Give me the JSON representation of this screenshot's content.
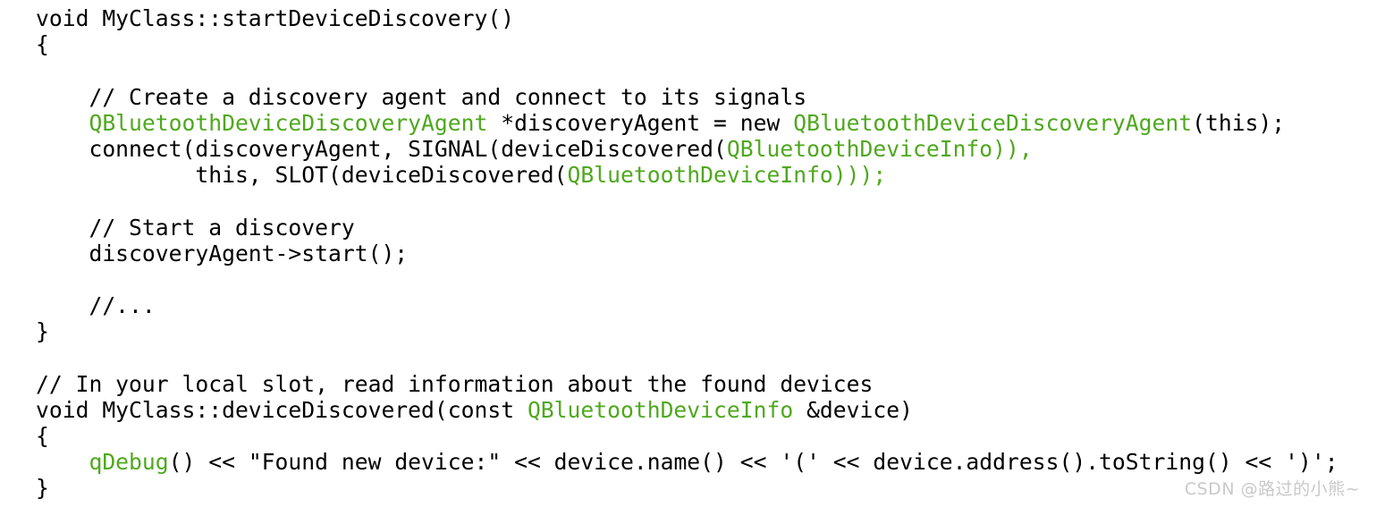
{
  "page": {
    "background_color": "#ffffff",
    "text_color": "#000000",
    "accent_color": "#4FA81E",
    "language": "cpp"
  },
  "code": {
    "lines": [
      {
        "index": 1,
        "indent": 0,
        "text": "void MyClass::startDeviceDiscovery()",
        "tokens": [
          {
            "t": "void MyClass::startDeviceDiscovery()",
            "c": "plain"
          }
        ]
      },
      {
        "index": 2,
        "indent": 0,
        "text": "{",
        "tokens": [
          {
            "t": "{",
            "c": "plain"
          }
        ]
      },
      {
        "index": 3,
        "indent": 0,
        "text": "",
        "tokens": []
      },
      {
        "index": 4,
        "indent": 4,
        "text": "    // Create a discovery agent and connect to its signals",
        "tokens": [
          {
            "t": "    // Create a discovery agent and connect to its signals",
            "c": "plain"
          }
        ]
      },
      {
        "index": 5,
        "indent": 4,
        "text": "    QBluetoothDeviceDiscoveryAgent *discoveryAgent = new QBluetoothDeviceDiscoveryAgent(this);",
        "tokens": [
          {
            "t": "    ",
            "c": "plain"
          },
          {
            "t": "QBluetoothDeviceDiscoveryAgent",
            "c": "type"
          },
          {
            "t": " *discoveryAgent = new ",
            "c": "plain"
          },
          {
            "t": "QBluetoothDeviceDiscoveryAgent",
            "c": "type"
          },
          {
            "t": "(this);",
            "c": "plain"
          }
        ]
      },
      {
        "index": 6,
        "indent": 4,
        "text": "    connect(discoveryAgent, SIGNAL(deviceDiscovered(QBluetoothDeviceInfo)),",
        "tokens": [
          {
            "t": "    connect(discoveryAgent, SIGNAL(deviceDiscovered(",
            "c": "plain"
          },
          {
            "t": "QBluetoothDeviceInfo",
            "c": "type"
          },
          {
            "t": ")),",
            "c": "type"
          }
        ]
      },
      {
        "index": 7,
        "indent": 12,
        "text": "            this, SLOT(deviceDiscovered(QBluetoothDeviceInfo)));",
        "tokens": [
          {
            "t": "            this, SLOT(deviceDiscovered(",
            "c": "plain"
          },
          {
            "t": "QBluetoothDeviceInfo",
            "c": "type"
          },
          {
            "t": ")));",
            "c": "type"
          }
        ]
      },
      {
        "index": 8,
        "indent": 0,
        "text": "",
        "tokens": []
      },
      {
        "index": 9,
        "indent": 4,
        "text": "    // Start a discovery",
        "tokens": [
          {
            "t": "    // Start a discovery",
            "c": "plain"
          }
        ]
      },
      {
        "index": 10,
        "indent": 4,
        "text": "    discoveryAgent->start();",
        "tokens": [
          {
            "t": "    discoveryAgent->start();",
            "c": "plain"
          }
        ]
      },
      {
        "index": 11,
        "indent": 0,
        "text": "",
        "tokens": []
      },
      {
        "index": 12,
        "indent": 4,
        "text": "    //...",
        "tokens": [
          {
            "t": "    //...",
            "c": "plain"
          }
        ]
      },
      {
        "index": 13,
        "indent": 0,
        "text": "}",
        "tokens": [
          {
            "t": "}",
            "c": "plain"
          }
        ]
      },
      {
        "index": 14,
        "indent": 0,
        "text": "",
        "tokens": []
      },
      {
        "index": 15,
        "indent": 0,
        "text": "// In your local slot, read information about the found devices",
        "tokens": [
          {
            "t": "// In your local slot, read information about the found devices",
            "c": "plain"
          }
        ]
      },
      {
        "index": 16,
        "indent": 0,
        "text": "void MyClass::deviceDiscovered(const QBluetoothDeviceInfo &device)",
        "tokens": [
          {
            "t": "void MyClass::deviceDiscovered(const ",
            "c": "plain"
          },
          {
            "t": "QBluetoothDeviceInfo",
            "c": "type"
          },
          {
            "t": " &device)",
            "c": "plain"
          }
        ]
      },
      {
        "index": 17,
        "indent": 0,
        "text": "{",
        "tokens": [
          {
            "t": "{",
            "c": "plain"
          }
        ]
      },
      {
        "index": 18,
        "indent": 4,
        "text": "    qDebug() << \"Found new device:\" << device.name() << '(' << device.address().toString() << ')';",
        "tokens": [
          {
            "t": "    ",
            "c": "plain"
          },
          {
            "t": "qDebug",
            "c": "func"
          },
          {
            "t": "() << \"Found new device:\" << device.name() << '(' << device.address().toString() << ')';",
            "c": "plain"
          }
        ]
      },
      {
        "index": 19,
        "indent": 0,
        "text": "}",
        "tokens": [
          {
            "t": "}",
            "c": "plain"
          }
        ]
      }
    ]
  },
  "watermark": {
    "text": "CSDN @路过的小熊~",
    "color": "#c9c9c9"
  }
}
